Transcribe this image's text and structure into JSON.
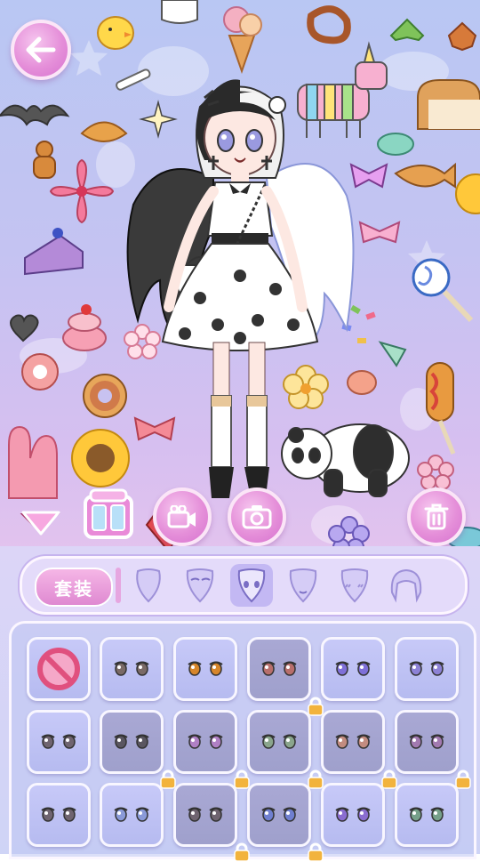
{
  "panel": {
    "suit_label": "套装",
    "category_tabs": [
      "face-shape",
      "eyebrows",
      "eyes",
      "mouth",
      "blush",
      "hair"
    ],
    "selected_tab": "eyes"
  },
  "grid": {
    "rows": [
      [
        {
          "item": "none"
        },
        {
          "item": "eyes-1",
          "color": "#7a6a66"
        },
        {
          "item": "eyes-2",
          "color": "#d7862b"
        },
        {
          "item": "eyes-3",
          "color": "#b86f6c",
          "locked": true
        },
        {
          "item": "eyes-4",
          "color": "#7f70d8"
        },
        {
          "item": "eyes-5",
          "color": "#8d82d6"
        }
      ],
      [
        {
          "item": "eyes-6",
          "color": "#6f6470",
          "locked": false
        },
        {
          "item": "eyes-7",
          "color": "#5a5660",
          "locked": true
        },
        {
          "item": "eyes-8",
          "color": "#b080c4",
          "locked": true
        },
        {
          "item": "eyes-9",
          "color": "#8aa58c",
          "locked": true
        },
        {
          "item": "eyes-10",
          "color": "#c28c80",
          "locked": true
        },
        {
          "item": "eyes-11",
          "color": "#a27ab0",
          "locked": true
        }
      ],
      [
        {
          "item": "eyes-12",
          "color": "#6f6470"
        },
        {
          "item": "eyes-13",
          "color": "#8a9ad8"
        },
        {
          "item": "eyes-14",
          "color": "#6f6470",
          "locked": true
        },
        {
          "item": "eyes-15",
          "color": "#6f7fd0",
          "locked": true
        },
        {
          "item": "eyes-16",
          "color": "#8a6dd0"
        },
        {
          "item": "eyes-17",
          "color": "#76a08a"
        }
      ]
    ]
  },
  "colors": {
    "accent": "#e58fd9",
    "panel": "#dcd5f7",
    "lock": "#f2b33d"
  }
}
